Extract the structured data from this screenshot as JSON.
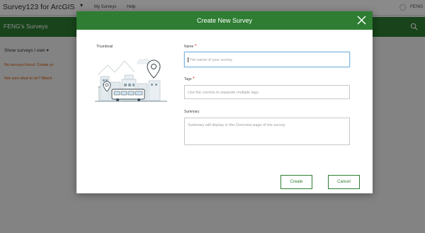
{
  "app": {
    "title": "Survey123 for ArcGIS",
    "title_caret": "▾",
    "nav": [
      "My Surveys",
      "Help"
    ],
    "user": "FENG",
    "section_title": "FENG's Surveys",
    "filter_label": "Show surveys I own",
    "filter_caret": "▾",
    "notice_1": "No surveys found. Create yo",
    "notice_2": "Not sure what to do? Watch"
  },
  "modal": {
    "title": "Create New Survey",
    "thumbnail_label": "Thumbnail",
    "name_label": "Name",
    "name_placeholder": "The name of your survey",
    "tags_label": "Tags",
    "tags_placeholder": "Use the comma to separate multiple tags",
    "summary_label": "Summary",
    "summary_placeholder": "Summary will display in the Overview page of the survey",
    "required_mark": "*",
    "create_label": "Create",
    "cancel_label": "Cancel"
  },
  "colors": {
    "brand_green": "#2e7d32",
    "required_red": "#d83020",
    "notice_orange": "#d35400",
    "focus_blue": "#7fb8e0"
  },
  "icons": {
    "close": "close-icon",
    "search": "search-icon",
    "avatar": "user-avatar-icon",
    "thumbnail": "survey-thumbnail-illustration"
  }
}
